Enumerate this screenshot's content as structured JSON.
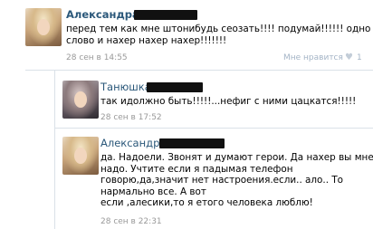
{
  "comments": [
    {
      "author": "Александра",
      "lines": [
        "перед тем как мне штонибудь сеозать!!!! подумай!!!!!! одно",
        "слово и нахер нахер нахер!!!!!!!"
      ],
      "date": "28 сен в 14:55",
      "like_label": "Мне нравится",
      "like_count": "1"
    },
    {
      "author": "Танюшка",
      "lines": [
        "так идолжно быть!!!!!...нефиг с ними цацкатся!!!!!"
      ],
      "date": "28 сен в 17:52"
    },
    {
      "author": "Александра",
      "lines": [
        "да. Надоели. Звонят и думают герои. Да нахер вы мне",
        "надо. Учтите если я падымая телефон",
        "говорю,да,значит нет настроения.если.. ало.. То",
        "нармально все. А вот",
        "если ,алесики,то я етого человека люблю!"
      ],
      "date": "28 сен в 22:31"
    }
  ]
}
